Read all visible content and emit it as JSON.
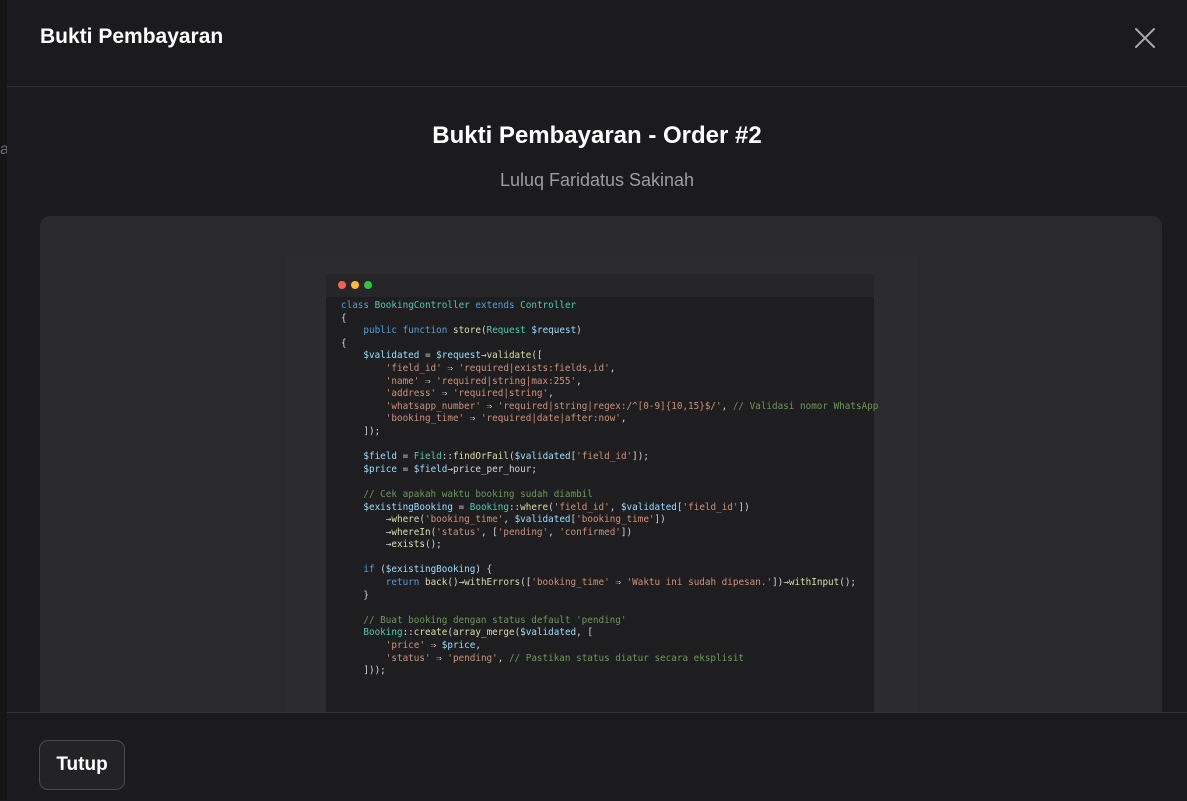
{
  "modal": {
    "title": "Bukti Pembayaran",
    "close_icon": "close-icon",
    "heading": "Bukti Pembayaran - Order #2",
    "customer_name": "Luluq Faridatus Sakinah",
    "footer_button": "Tutup"
  },
  "backdrop": {
    "glyph": "a"
  },
  "proof_image": {
    "code_lines": [
      "class BookingController extends Controller",
      "{",
      "    public function store(Request $request)",
      "{",
      "    $validated = $request→validate([",
      "        'field_id' ⇒ 'required|exists:fields,id',",
      "        'name' ⇒ 'required|string|max:255',",
      "        'address' ⇒ 'required|string',",
      "        'whatsapp_number' ⇒ 'required|string|regex:/^[0-9]{10,15}$/', // Validasi nomor WhatsApp",
      "        'booking_time' ⇒ 'required|date|after:now',",
      "    ]);",
      "",
      "    $field = Field::findOrFail($validated['field_id']);",
      "    $price = $field→price_per_hour;",
      "",
      "    // Cek apakah waktu booking sudah diambil",
      "    $existingBooking = Booking::where('field_id', $validated['field_id'])",
      "        →where('booking_time', $validated['booking_time'])",
      "        →whereIn('status', ['pending', 'confirmed'])",
      "        →exists();",
      "",
      "    if ($existingBooking) {",
      "        return back()→withErrors(['booking_time' ⇒ 'Waktu ini sudah dipesan.'])→withInput();",
      "    }",
      "",
      "    // Buat booking dengan status default 'pending'",
      "    Booking::create(array_merge($validated, [",
      "        'price' ⇒ $price,",
      "        'status' ⇒ 'pending', // Pastikan status diatur secara eksplisit",
      "    ]));"
    ]
  },
  "colors": {
    "background": "#1b1b1d",
    "image_frame": "#2a2a2c",
    "keyword": "#569cd6",
    "string": "#ce9178",
    "comment": "#6a9955",
    "function": "#dcdcaa",
    "variable": "#9cdcfe",
    "class": "#4ec9b0"
  }
}
